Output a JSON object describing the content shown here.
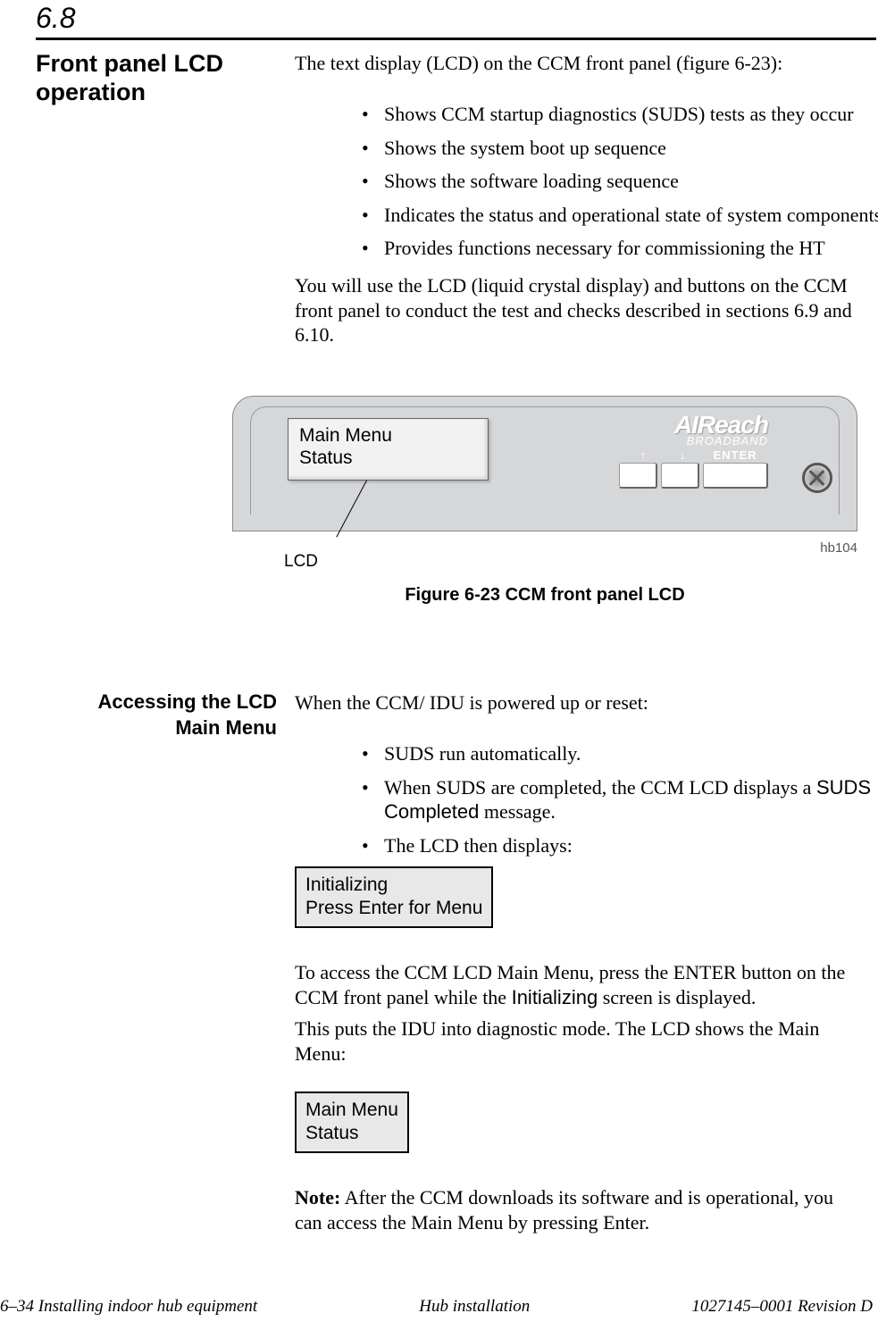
{
  "section_number": "6.8",
  "heading_left": "Front panel LCD operation",
  "intro": "The text display (LCD) on the CCM front panel (figure 6-23):",
  "bullets": [
    "Shows CCM startup diagnostics (SUDS) tests as they occur",
    "Shows the system boot up sequence",
    "Shows the software loading sequence",
    "Indicates the status and operational state of system components",
    "Provides functions necessary for commissioning the HT"
  ],
  "after_bullets": "You will use the LCD (liquid crystal display) and buttons on the CCM front panel to conduct the test and checks described in sections 6.9 and 6.10.",
  "figure": {
    "lcd_line1": "Main Menu",
    "lcd_line2": "Status",
    "brand": "AIReach",
    "brand_sub": "BROADBAND",
    "up_icon": "↑",
    "down_icon": "↓",
    "enter_label": "ENTER",
    "lcd_callout": "LCD",
    "fig_id": "hb104",
    "caption": "Figure  6-23    CCM front panel LCD"
  },
  "sub_heading": "Accessing the LCD Main Menu",
  "sec2_intro": "When the CCM/ IDU is powered up or reset:",
  "bullets2": {
    "b1": "SUDS run automatically.",
    "b2_pre": "When SUDS are completed, the CCM LCD displays a ",
    "b2_sans": "SUDS Completed",
    "b2_post": " message.",
    "b3": "The LCD then displays:"
  },
  "lcd_box1": {
    "line1": "Initializing",
    "line2": "Press Enter for Menu"
  },
  "para_access_pre": "To access the CCM LCD Main Menu, press the ENTER button on the CCM front panel while the ",
  "para_access_sans": "Initializing",
  "para_access_post": " screen is displayed.",
  "para_mode": "This puts the IDU into diagnostic mode. The LCD shows the Main Menu:",
  "lcd_box2": {
    "line1": "Main Menu",
    "line2": "Status"
  },
  "note_label": "Note:",
  "note_text": " After the CCM downloads its software and is operational, you can access the Main Menu by pressing Enter.",
  "footer": {
    "left": "6–34  Installing indoor hub equipment",
    "center": "Hub installation",
    "right": "1027145–0001   Revision D"
  }
}
